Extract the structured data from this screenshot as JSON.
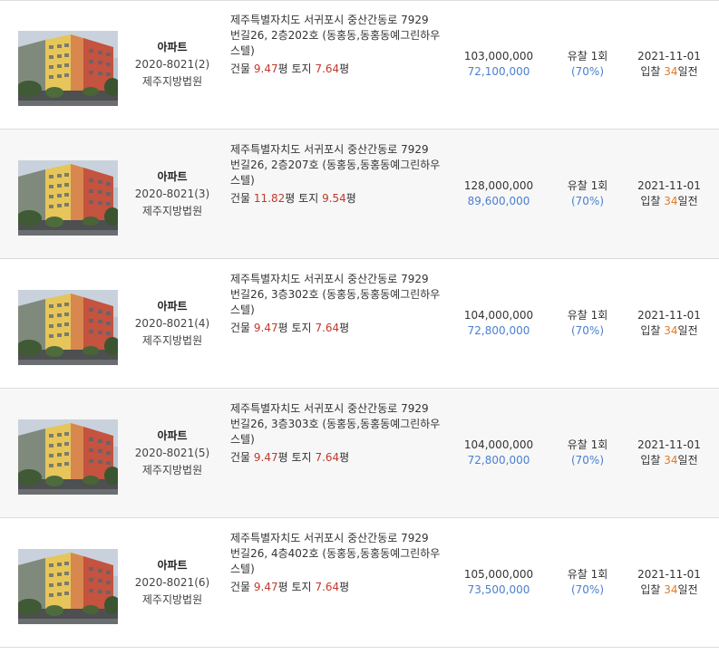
{
  "listings": [
    {
      "property_type": "아파트",
      "case_number": "2020-8021(2)",
      "court": "제주지방법원",
      "address_lines": [
        "제주특별자치도 서귀포시 중산간동로 7929",
        "번길26, 2층202호 (동홍동,동홍동예그린하우",
        "스텔)"
      ],
      "area": {
        "building_label": "건물",
        "building_value": "9.47",
        "unit": "평",
        "land_label": "토지",
        "land_value": "7.64"
      },
      "appraisal_price": "103,000,000",
      "minimum_price": "72,100,000",
      "fail_label": "유찰 1회",
      "percent": "(70%)",
      "date": "2021-11-01",
      "dday_prefix": "입찰 ",
      "dday_days": "34",
      "dday_suffix": "일전"
    },
    {
      "property_type": "아파트",
      "case_number": "2020-8021(3)",
      "court": "제주지방법원",
      "address_lines": [
        "제주특별자치도 서귀포시 중산간동로 7929",
        "번길26, 2층207호 (동홍동,동홍동예그린하우",
        "스텔)"
      ],
      "area": {
        "building_label": "건물",
        "building_value": "11.82",
        "unit": "평",
        "land_label": "토지",
        "land_value": "9.54"
      },
      "appraisal_price": "128,000,000",
      "minimum_price": "89,600,000",
      "fail_label": "유찰 1회",
      "percent": "(70%)",
      "date": "2021-11-01",
      "dday_prefix": "입찰 ",
      "dday_days": "34",
      "dday_suffix": "일전"
    },
    {
      "property_type": "아파트",
      "case_number": "2020-8021(4)",
      "court": "제주지방법원",
      "address_lines": [
        "제주특별자치도 서귀포시 중산간동로 7929",
        "번길26, 3층302호 (동홍동,동홍동예그린하우",
        "스텔)"
      ],
      "area": {
        "building_label": "건물",
        "building_value": "9.47",
        "unit": "평",
        "land_label": "토지",
        "land_value": "7.64"
      },
      "appraisal_price": "104,000,000",
      "minimum_price": "72,800,000",
      "fail_label": "유찰 1회",
      "percent": "(70%)",
      "date": "2021-11-01",
      "dday_prefix": "입찰 ",
      "dday_days": "34",
      "dday_suffix": "일전"
    },
    {
      "property_type": "아파트",
      "case_number": "2020-8021(5)",
      "court": "제주지방법원",
      "address_lines": [
        "제주특별자치도 서귀포시 중산간동로 7929",
        "번길26, 3층303호 (동홍동,동홍동예그린하우",
        "스텔)"
      ],
      "area": {
        "building_label": "건물",
        "building_value": "9.47",
        "unit": "평",
        "land_label": "토지",
        "land_value": "7.64"
      },
      "appraisal_price": "104,000,000",
      "minimum_price": "72,800,000",
      "fail_label": "유찰 1회",
      "percent": "(70%)",
      "date": "2021-11-01",
      "dday_prefix": "입찰 ",
      "dday_days": "34",
      "dday_suffix": "일전"
    },
    {
      "property_type": "아파트",
      "case_number": "2020-8021(6)",
      "court": "제주지방법원",
      "address_lines": [
        "제주특별자치도 서귀포시 중산간동로 7929",
        "번길26, 4층402호 (동홍동,동홍동예그린하우",
        "스텔)"
      ],
      "area": {
        "building_label": "건물",
        "building_value": "9.47",
        "unit": "평",
        "land_label": "토지",
        "land_value": "7.64"
      },
      "appraisal_price": "105,000,000",
      "minimum_price": "73,500,000",
      "fail_label": "유찰 1회",
      "percent": "(70%)",
      "date": "2021-11-01",
      "dday_prefix": "입찰 ",
      "dday_days": "34",
      "dday_suffix": "일전"
    }
  ],
  "colors": {
    "row_alt_background": "#f7f7f7",
    "minimum_price": "#4a7fcf",
    "area_value": "#c0392b",
    "dday_days": "#e07b2a",
    "divider": "#dcdcdc"
  }
}
